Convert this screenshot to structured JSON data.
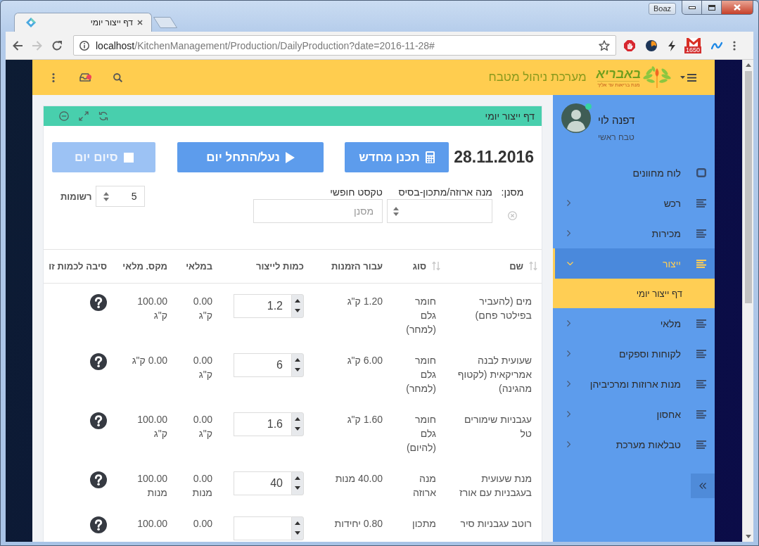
{
  "browser": {
    "tab_title": "דף ייצור יומי",
    "profile": "Boaz",
    "forward_disabled": true,
    "url": {
      "host": "localhost",
      "path": "/KitchenManagement/Production/DailyProduction?date=2016-11-28#"
    },
    "mail_badge": "1650"
  },
  "header": {
    "title": "מערכת ניהול מטבח",
    "logo": {
      "name": "באבריא",
      "tagline": "מנת בריאות עד אליך"
    },
    "has_notification": true
  },
  "sidebar": {
    "user": {
      "name": "דפנה לוי",
      "role": "טבח ראשי",
      "online": true
    },
    "menu": [
      {
        "label": "לוח מחוונים",
        "kind": "link",
        "selected": false
      },
      {
        "label": "רכש",
        "kind": "group",
        "selected": false,
        "expanded": false
      },
      {
        "label": "מכירות",
        "kind": "group",
        "selected": false,
        "expanded": false
      },
      {
        "label": "ייצור",
        "kind": "group",
        "selected": true,
        "expanded": true,
        "children": [
          {
            "label": "דף ייצור יומי",
            "selected": true
          }
        ]
      },
      {
        "label": "מלאי",
        "kind": "group",
        "selected": false,
        "expanded": false
      },
      {
        "label": "לקוחות וספקים",
        "kind": "group",
        "selected": false,
        "expanded": false
      },
      {
        "label": "מנות ארוזות ומרכיביהן",
        "kind": "group",
        "selected": false,
        "expanded": false
      },
      {
        "label": "אחסון",
        "kind": "group",
        "selected": false,
        "expanded": false
      },
      {
        "label": "טבלאות מערכת",
        "kind": "group",
        "selected": false,
        "expanded": false
      }
    ]
  },
  "panel": {
    "title": "דף ייצור יומי",
    "date": "28.11.2016",
    "buttons": [
      {
        "label": "תכנן מחדש",
        "kind": "recalculate",
        "disabled": false
      },
      {
        "label": "נעל/התחל יום",
        "kind": "start",
        "disabled": false
      },
      {
        "label": "סיום יום",
        "kind": "stop",
        "disabled": true
      }
    ],
    "filter": {
      "label": "מסנן:",
      "fields": [
        {
          "kind": "select",
          "label": "מנה ארוזה/מתכון-בסיס"
        },
        {
          "kind": "text",
          "label": "טקסט חופשי",
          "placeholder": "מסנן"
        }
      ]
    },
    "page_size": {
      "value": "5",
      "label": "רשומות"
    }
  },
  "table": {
    "columns": [
      {
        "label": "שם",
        "sortable": true
      },
      {
        "label": "סוג",
        "sortable": true
      },
      {
        "label": "עבור הזמנות",
        "sortable": false
      },
      {
        "label": "כמות לייצור",
        "sortable": false
      },
      {
        "label": "במלאי",
        "sortable": false
      },
      {
        "label": "מקס. מלאי",
        "sortable": false
      },
      {
        "label": "סיבה לכמות זו",
        "sortable": false
      }
    ],
    "rows": [
      {
        "name": "מים (להעביר בפילטר פחם)",
        "type": "חומר גלם (למחר)",
        "for_orders": "1.20 ק\"ג",
        "quantity": "1.2",
        "in_stock": "0.00 ק\"ג",
        "max_stock": "100.00 ק\"ג"
      },
      {
        "name": "שעועית לבנה אמריקאית (לקטוף מהגינה)",
        "type": "חומר גלם (למחר)",
        "for_orders": "6.00 ק\"ג",
        "quantity": "6",
        "in_stock": "0.00 ק\"ג",
        "max_stock": "0.00 ק\"ג"
      },
      {
        "name": "עגבניות שימורים טל",
        "type": "חומר גלם (להיום)",
        "for_orders": "1.60 ק\"ג",
        "quantity": "1.6",
        "in_stock": "0.00 ק\"ג",
        "max_stock": "100.00 ק\"ג"
      },
      {
        "name": "מנת שעועית בעגבניות עם אורז",
        "type": "מנה ארוזה",
        "for_orders": "40.00 מנות",
        "quantity": "40",
        "in_stock": "0.00 מנות",
        "max_stock": "100.00 מנות"
      },
      {
        "name": "רוטב עגבניות סיר",
        "type": "מתכון",
        "for_orders": "0.80 יחידות",
        "in_stock": "0.00",
        "max_stock": "100.00"
      }
    ]
  }
}
